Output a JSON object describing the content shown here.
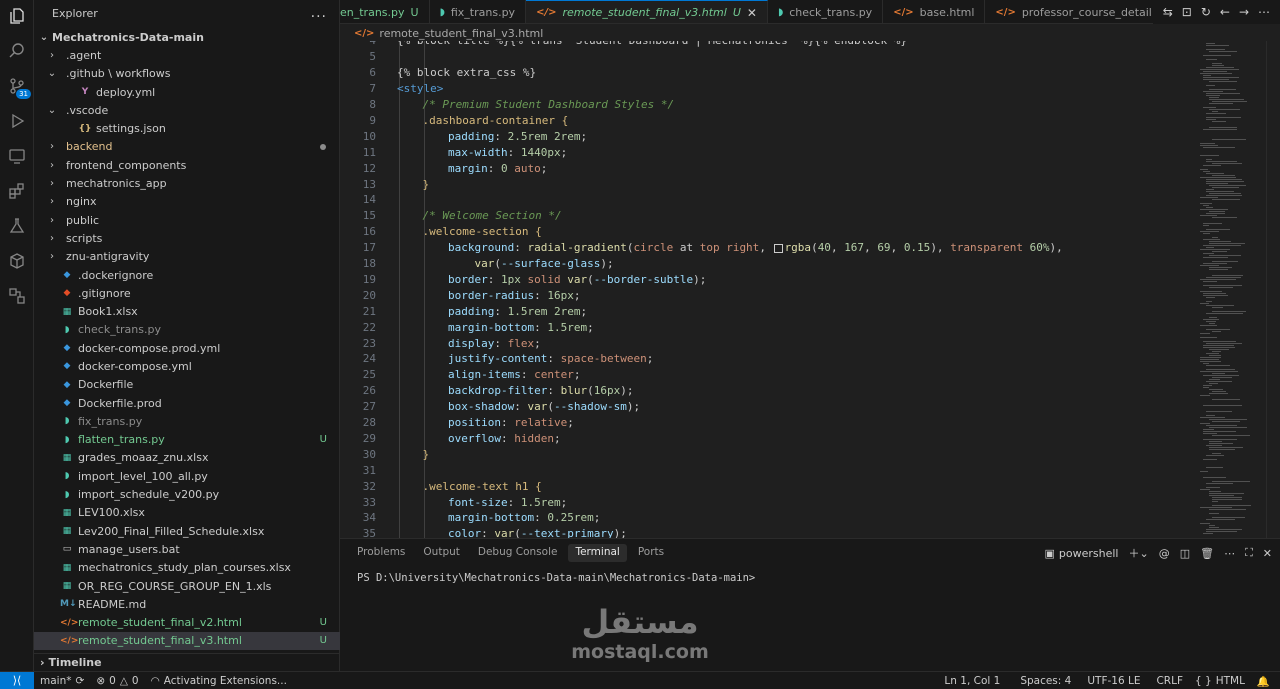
{
  "sidebar": {
    "title": "Explorer",
    "more": "...",
    "root": "Mechatronics-Data-main",
    "timeline": "Timeline",
    "items": [
      {
        "label": "agent",
        "kind": "folder",
        "open": false,
        "depth": 1
      },
      {
        "label": "github \\ workflows",
        "kind": "folder",
        "open": true,
        "depth": 1
      },
      {
        "label": "deploy.yml",
        "kind": "yml",
        "depth": 2
      },
      {
        "label": "vscode",
        "kind": "folder",
        "open": true,
        "depth": 1
      },
      {
        "label": "settings.json",
        "kind": "json",
        "depth": 2
      },
      {
        "label": "backend",
        "kind": "folder",
        "open": false,
        "depth": 1,
        "dot": true,
        "style": "mod"
      },
      {
        "label": "frontend_components",
        "kind": "folder",
        "open": false,
        "depth": 1
      },
      {
        "label": "mechatronics_app",
        "kind": "folder",
        "open": false,
        "depth": 1
      },
      {
        "label": "nginx",
        "kind": "folder",
        "open": false,
        "depth": 1
      },
      {
        "label": "public",
        "kind": "folder",
        "open": false,
        "depth": 1
      },
      {
        "label": "scripts",
        "kind": "folder",
        "open": false,
        "depth": 1
      },
      {
        "label": "znu-antigravity",
        "kind": "folder",
        "open": false,
        "depth": 1
      },
      {
        "label": ".dockerignore",
        "kind": "docker",
        "depth": 1
      },
      {
        "label": ".gitignore",
        "kind": "git",
        "depth": 1
      },
      {
        "label": "Book1.xlsx",
        "kind": "xlsx",
        "depth": 1
      },
      {
        "label": "check_trans.py",
        "kind": "py",
        "depth": 1,
        "style": "ign"
      },
      {
        "label": "docker-compose.prod.yml",
        "kind": "docker",
        "depth": 1
      },
      {
        "label": "docker-compose.yml",
        "kind": "docker",
        "depth": 1
      },
      {
        "label": "Dockerfile",
        "kind": "docker",
        "depth": 1
      },
      {
        "label": "Dockerfile.prod",
        "kind": "docker",
        "depth": 1
      },
      {
        "label": "fix_trans.py",
        "kind": "py",
        "depth": 1,
        "style": "ign"
      },
      {
        "label": "flatten_trans.py",
        "kind": "py",
        "depth": 1,
        "style": "mod",
        "status": "U"
      },
      {
        "label": "grades_moaaz_znu.xlsx",
        "kind": "xlsx",
        "depth": 1
      },
      {
        "label": "import_level_100_all.py",
        "kind": "py",
        "depth": 1
      },
      {
        "label": "import_schedule_v200.py",
        "kind": "py",
        "depth": 1
      },
      {
        "label": "LEV100.xlsx",
        "kind": "xlsx",
        "depth": 1
      },
      {
        "label": "Lev200_Final_Filled_Schedule.xlsx",
        "kind": "xlsx",
        "depth": 1
      },
      {
        "label": "manage_users.bat",
        "kind": "bat",
        "depth": 1
      },
      {
        "label": "mechatronics_study_plan_courses.xlsx",
        "kind": "xlsx",
        "depth": 1
      },
      {
        "label": "OR_REG_COURSE_GROUP_EN_1.xls",
        "kind": "xlsx",
        "depth": 1
      },
      {
        "label": "README.md",
        "kind": "md",
        "depth": 1
      },
      {
        "label": "remote_student_final_v2.html",
        "kind": "html",
        "depth": 1,
        "style": "mod",
        "status": "U"
      },
      {
        "label": "remote_student_final_v3.html",
        "kind": "html",
        "depth": 1,
        "style": "mod",
        "status": "U",
        "selected": true
      }
    ]
  },
  "tabs": [
    {
      "label": "en_trans.py",
      "kind": "py",
      "status": "U"
    },
    {
      "label": "fix_trans.py",
      "kind": "py"
    },
    {
      "label": "remote_student_final_v3.html",
      "kind": "html",
      "status": "U",
      "active": true
    },
    {
      "label": "check_trans.py",
      "kind": "py"
    },
    {
      "label": "base.html",
      "kind": "html"
    },
    {
      "label": "professor_course_detail.html",
      "kind": "html"
    }
  ],
  "breadcrumb": "remote_student_final_v3.html",
  "editor": {
    "lines": [
      {
        "n": "4",
        "t": [
          [
            "{% block title %}{% trans \"Student Dashboard | Mechatronics\" %}{% endblock %}",
            "code"
          ]
        ],
        "i": 0
      },
      {
        "n": "5",
        "t": [],
        "i": 0
      },
      {
        "n": "6",
        "t": [
          [
            "{% block extra_css %}",
            "code"
          ]
        ],
        "i": 0
      },
      {
        "n": "7",
        "t": [
          [
            "<style>",
            "tag"
          ]
        ],
        "i": 0
      },
      {
        "n": "8",
        "t": [
          [
            "/* Premium Student Dashboard Styles */",
            "cmt"
          ]
        ],
        "i": 1
      },
      {
        "n": "9",
        "t": [
          [
            ".dashboard-container {",
            "sel"
          ]
        ],
        "i": 1
      },
      {
        "n": "10",
        "t": [
          [
            "padding",
            "prop"
          ],
          [
            ": ",
            "code"
          ],
          [
            "2.5rem 2rem",
            "num"
          ],
          [
            ";",
            "code"
          ]
        ],
        "i": 2
      },
      {
        "n": "11",
        "t": [
          [
            "max-width",
            "prop"
          ],
          [
            ": ",
            "code"
          ],
          [
            "1440px",
            "num"
          ],
          [
            ";",
            "code"
          ]
        ],
        "i": 2
      },
      {
        "n": "12",
        "t": [
          [
            "margin",
            "prop"
          ],
          [
            ": ",
            "code"
          ],
          [
            "0",
            "num"
          ],
          [
            " ",
            "code"
          ],
          [
            "auto",
            "val"
          ],
          [
            ";",
            "code"
          ]
        ],
        "i": 2
      },
      {
        "n": "13",
        "t": [
          [
            "}",
            "sel"
          ]
        ],
        "i": 1
      },
      {
        "n": "14",
        "t": [],
        "i": 0
      },
      {
        "n": "15",
        "t": [
          [
            "/* Welcome Section */",
            "cmt"
          ]
        ],
        "i": 1
      },
      {
        "n": "16",
        "t": [
          [
            ".welcome-section {",
            "sel"
          ]
        ],
        "i": 1
      },
      {
        "n": "17",
        "t": [
          [
            "background",
            "prop"
          ],
          [
            ": ",
            "code"
          ],
          [
            "radial-gradient",
            "fn"
          ],
          [
            "(",
            "code"
          ],
          [
            "circle",
            "val"
          ],
          [
            " at ",
            "code"
          ],
          [
            "top right",
            "val"
          ],
          [
            ", ",
            "code"
          ],
          [
            "SWATCH",
            "swatch"
          ],
          [
            "rgba",
            "fn"
          ],
          [
            "(",
            "code"
          ],
          [
            "40",
            "num"
          ],
          [
            ", ",
            "code"
          ],
          [
            "167",
            "num"
          ],
          [
            ", ",
            "code"
          ],
          [
            "69",
            "num"
          ],
          [
            ", ",
            "code"
          ],
          [
            "0.15",
            "num"
          ],
          [
            "), ",
            "code"
          ],
          [
            "transparent",
            "val"
          ],
          [
            " ",
            "code"
          ],
          [
            "60%",
            "num"
          ],
          [
            "),",
            "code"
          ]
        ],
        "i": 2
      },
      {
        "n": "18",
        "t": [
          [
            "    var",
            "fn"
          ],
          [
            "(",
            "code"
          ],
          [
            "--surface-glass",
            "prop"
          ],
          [
            ");",
            "code"
          ]
        ],
        "i": 2
      },
      {
        "n": "19",
        "t": [
          [
            "border",
            "prop"
          ],
          [
            ": ",
            "code"
          ],
          [
            "1px",
            "num"
          ],
          [
            " ",
            "code"
          ],
          [
            "solid",
            "val"
          ],
          [
            " ",
            "code"
          ],
          [
            "var",
            "fn"
          ],
          [
            "(",
            "code"
          ],
          [
            "--border-subtle",
            "prop"
          ],
          [
            ");",
            "code"
          ]
        ],
        "i": 2
      },
      {
        "n": "20",
        "t": [
          [
            "border-radius",
            "prop"
          ],
          [
            ": ",
            "code"
          ],
          [
            "16px",
            "num"
          ],
          [
            ";",
            "code"
          ]
        ],
        "i": 2
      },
      {
        "n": "21",
        "t": [
          [
            "padding",
            "prop"
          ],
          [
            ": ",
            "code"
          ],
          [
            "1.5rem 2rem",
            "num"
          ],
          [
            ";",
            "code"
          ]
        ],
        "i": 2
      },
      {
        "n": "22",
        "t": [
          [
            "margin-bottom",
            "prop"
          ],
          [
            ": ",
            "code"
          ],
          [
            "1.5rem",
            "num"
          ],
          [
            ";",
            "code"
          ]
        ],
        "i": 2
      },
      {
        "n": "23",
        "t": [
          [
            "display",
            "prop"
          ],
          [
            ": ",
            "code"
          ],
          [
            "flex",
            "val"
          ],
          [
            ";",
            "code"
          ]
        ],
        "i": 2
      },
      {
        "n": "24",
        "t": [
          [
            "justify-content",
            "prop"
          ],
          [
            ": ",
            "code"
          ],
          [
            "space-between",
            "val"
          ],
          [
            ";",
            "code"
          ]
        ],
        "i": 2
      },
      {
        "n": "25",
        "t": [
          [
            "align-items",
            "prop"
          ],
          [
            ": ",
            "code"
          ],
          [
            "center",
            "val"
          ],
          [
            ";",
            "code"
          ]
        ],
        "i": 2
      },
      {
        "n": "26",
        "t": [
          [
            "backdrop-filter",
            "prop"
          ],
          [
            ": ",
            "code"
          ],
          [
            "blur",
            "fn"
          ],
          [
            "(",
            "code"
          ],
          [
            "16px",
            "num"
          ],
          [
            ");",
            "code"
          ]
        ],
        "i": 2
      },
      {
        "n": "27",
        "t": [
          [
            "box-shadow",
            "prop"
          ],
          [
            ": ",
            "code"
          ],
          [
            "var",
            "fn"
          ],
          [
            "(",
            "code"
          ],
          [
            "--shadow-sm",
            "prop"
          ],
          [
            ");",
            "code"
          ]
        ],
        "i": 2
      },
      {
        "n": "28",
        "t": [
          [
            "position",
            "prop"
          ],
          [
            ": ",
            "code"
          ],
          [
            "relative",
            "val"
          ],
          [
            ";",
            "code"
          ]
        ],
        "i": 2
      },
      {
        "n": "29",
        "t": [
          [
            "overflow",
            "prop"
          ],
          [
            ": ",
            "code"
          ],
          [
            "hidden",
            "val"
          ],
          [
            ";",
            "code"
          ]
        ],
        "i": 2
      },
      {
        "n": "30",
        "t": [
          [
            "}",
            "sel"
          ]
        ],
        "i": 1
      },
      {
        "n": "31",
        "t": [],
        "i": 0
      },
      {
        "n": "32",
        "t": [
          [
            ".welcome-text h1 {",
            "sel"
          ]
        ],
        "i": 1
      },
      {
        "n": "33",
        "t": [
          [
            "font-size",
            "prop"
          ],
          [
            ": ",
            "code"
          ],
          [
            "1.5rem",
            "num"
          ],
          [
            ";",
            "code"
          ]
        ],
        "i": 2
      },
      {
        "n": "34",
        "t": [
          [
            "margin-bottom",
            "prop"
          ],
          [
            ": ",
            "code"
          ],
          [
            "0.25rem",
            "num"
          ],
          [
            ";",
            "code"
          ]
        ],
        "i": 2
      },
      {
        "n": "35",
        "t": [
          [
            "color",
            "prop"
          ],
          [
            ": ",
            "code"
          ],
          [
            "var",
            "fn"
          ],
          [
            "(",
            "code"
          ],
          [
            "--text-primary",
            "prop"
          ],
          [
            ");",
            "code"
          ]
        ],
        "i": 2
      }
    ]
  },
  "panel": {
    "tabs": [
      "Problems",
      "Output",
      "Debug Console",
      "Terminal",
      "Ports"
    ],
    "active_tab": "Terminal",
    "shell": "powershell",
    "terminal_line": "PS D:\\University\\Mechatronics-Data-main\\Mechatronics-Data-main>"
  },
  "watermark": {
    "arabic": "مستقل",
    "latin": "mostaql.com"
  },
  "statusbar": {
    "branch": "main*",
    "errors": "0",
    "warnings": "0",
    "activity": "Activating Extensions...",
    "position": "Ln 1, Col 1",
    "spaces": "Spaces: 4",
    "encoding": "UTF-16 LE",
    "eol": "CRLF",
    "language": "HTML"
  },
  "activity_badge": "31",
  "colors": {
    "accent": "#0078d4",
    "modified": "#73c991"
  }
}
